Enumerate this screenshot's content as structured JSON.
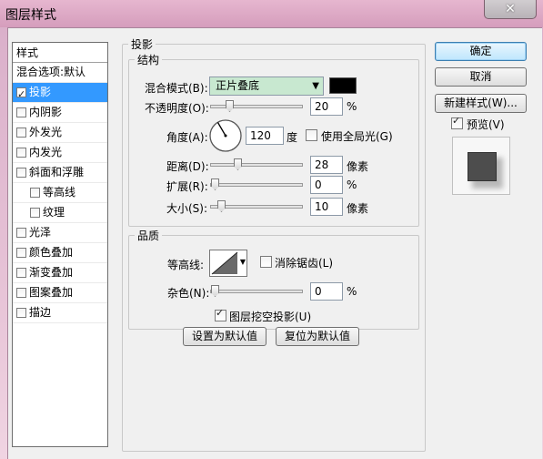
{
  "window": {
    "title": "图层样式",
    "close_glyph": "✕"
  },
  "styles_panel": {
    "header": "样式",
    "blend_options": "混合选项:默认",
    "items": [
      {
        "label": "投影",
        "checked": true,
        "selected": true
      },
      {
        "label": "内阴影",
        "checked": false
      },
      {
        "label": "外发光",
        "checked": false
      },
      {
        "label": "内发光",
        "checked": false
      },
      {
        "label": "斜面和浮雕",
        "checked": false
      },
      {
        "label": "等高线",
        "checked": false
      },
      {
        "label": "纹理",
        "checked": false
      },
      {
        "label": "光泽",
        "checked": false
      },
      {
        "label": "颜色叠加",
        "checked": false
      },
      {
        "label": "渐变叠加",
        "checked": false
      },
      {
        "label": "图案叠加",
        "checked": false
      },
      {
        "label": "描边",
        "checked": false
      }
    ]
  },
  "drop_shadow": {
    "group_title": "投影",
    "structure": {
      "title": "结构",
      "blend_mode_label": "混合模式(B):",
      "blend_mode_value": "正片叠底",
      "shadow_color": "#000000",
      "opacity_label": "不透明度(O):",
      "opacity_value": "20",
      "opacity_unit": "%",
      "angle_label": "角度(A):",
      "angle_value": "120",
      "angle_unit": "度",
      "global_light_label": "使用全局光(G)",
      "global_light_checked": false,
      "distance_label": "距离(D):",
      "distance_value": "28",
      "distance_unit": "像素",
      "spread_label": "扩展(R):",
      "spread_value": "0",
      "spread_unit": "%",
      "size_label": "大小(S):",
      "size_value": "10",
      "size_unit": "像素"
    },
    "quality": {
      "title": "品质",
      "contour_label": "等高线:",
      "anti_alias_label": "消除锯齿(L)",
      "anti_alias_checked": false,
      "noise_label": "杂色(N):",
      "noise_value": "0",
      "noise_unit": "%"
    },
    "knockout_label": "图层挖空投影(U)",
    "knockout_checked": true,
    "make_default": "设置为默认值",
    "reset_default": "复位为默认值"
  },
  "buttons": {
    "ok": "确定",
    "cancel": "取消",
    "new_style": "新建样式(W)...",
    "preview_label": "预览(V)",
    "preview_checked": true
  },
  "accent": "#3399ff"
}
